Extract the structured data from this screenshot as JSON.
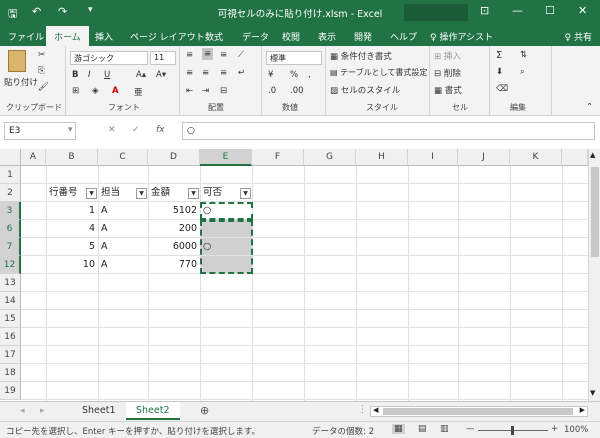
{
  "titlebar": {
    "title": "可視セルのみに貼り付け.xlsm  -  Excel",
    "save_icon": "save-icon",
    "undo_icon": "↶",
    "redo_icon": "↷",
    "qa_more": "▾"
  },
  "tabs": [
    {
      "label": "ファイル"
    },
    {
      "label": "ホーム"
    },
    {
      "label": "挿入"
    },
    {
      "label": "ページ レイアウト"
    },
    {
      "label": "数式"
    },
    {
      "label": "データ"
    },
    {
      "label": "校閲"
    },
    {
      "label": "表示"
    },
    {
      "label": "開発"
    },
    {
      "label": "ヘルプ"
    },
    {
      "label": "♀ 操作アシスト"
    }
  ],
  "share": "♀ 共有",
  "ribbon": {
    "clipboard": {
      "paste": "貼り付け",
      "label": "クリップボード"
    },
    "font": {
      "name": "游ゴシック",
      "size": "11",
      "label": "フォント",
      "bold": "B",
      "italic": "I",
      "underline": "U"
    },
    "align": {
      "label": "配置"
    },
    "number": {
      "format": "標準",
      "label": "数値",
      "percent": "%",
      "comma": ","
    },
    "styles": {
      "cond": "条件付き書式",
      "table": "テーブルとして書式設定",
      "cell": "セルのスタイル",
      "label": "スタイル"
    },
    "cells": {
      "insert": "挿入",
      "delete": "削除",
      "format": "書式",
      "label": "セル"
    },
    "editing": {
      "label": "編集"
    }
  },
  "formula": {
    "namebox": "E3",
    "value": "○",
    "fx": "fx",
    "cancel": "✕",
    "enter": "✓"
  },
  "columns": [
    "A",
    "B",
    "C",
    "D",
    "E",
    "F",
    "G",
    "H",
    "I",
    "J",
    "K"
  ],
  "rows": [
    "1",
    "2",
    "3",
    "6",
    "7",
    "12",
    "13",
    "14",
    "15",
    "16",
    "17",
    "18",
    "19"
  ],
  "table": {
    "headers": [
      "行番号",
      "担当",
      "金額",
      "可否"
    ],
    "data": [
      {
        "no": "1",
        "tanto": "A",
        "amount": "5102",
        "ok": "○"
      },
      {
        "no": "4",
        "tanto": "A",
        "amount": "200",
        "ok": ""
      },
      {
        "no": "5",
        "tanto": "A",
        "amount": "6000",
        "ok": "○"
      },
      {
        "no": "10",
        "tanto": "A",
        "amount": "770",
        "ok": ""
      }
    ]
  },
  "sheets": [
    "Sheet1",
    "Sheet2"
  ],
  "status": {
    "message": "コピー先を選択し、Enter キーを押すか、貼り付けを選択します。",
    "count": "データの個数: 2",
    "zoom": "100%"
  }
}
